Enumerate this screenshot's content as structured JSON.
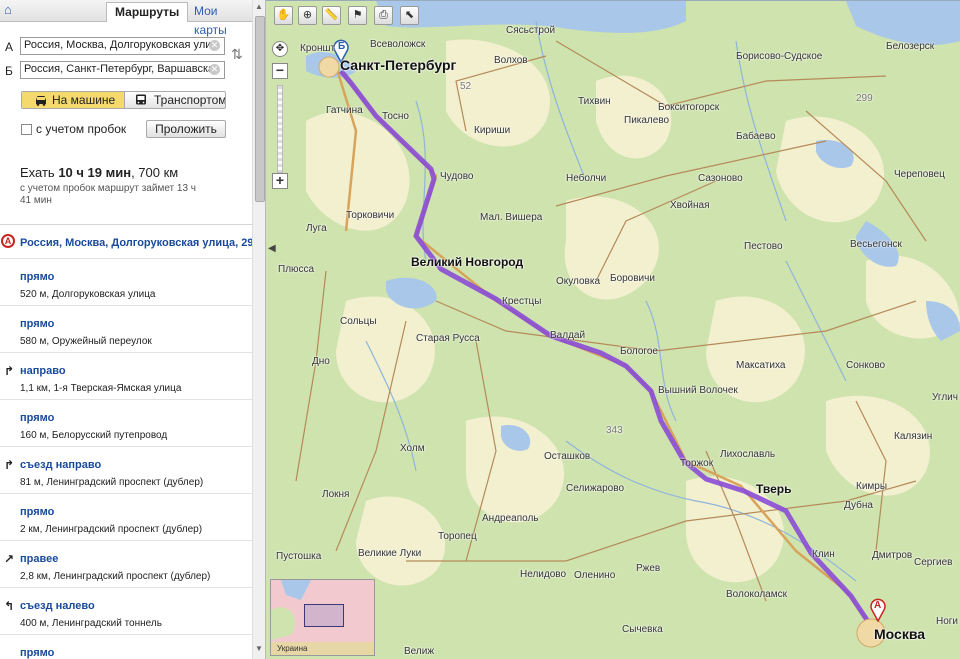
{
  "panel": {
    "tabs": {
      "routes": "Маршруты",
      "my_maps": "Мои карты"
    },
    "point_a_label": "А",
    "point_b_label": "Б",
    "from_value": "Россия, Москва, Долгоруковская ули",
    "to_value": "Россия, Санкт-Петербург, Варшавска",
    "mode_car": "На машине",
    "mode_transit": "Транспортом",
    "traffic_label": "с учетом пробок",
    "build_button": "Проложить",
    "summary_prefix": "Ехать ",
    "summary_time": "10 ч 19 мин",
    "summary_distance": ", 700 км",
    "summary_note": "с учетом пробок маршрут займет 13 ч 41 мин",
    "start_marker": "А",
    "start_address": "Россия, Москва, Долгоруковская улица, 29",
    "steps": [
      {
        "title": "прямо",
        "detail": "520 м, Долгоруковская улица",
        "turn": ""
      },
      {
        "title": "прямо",
        "detail": "580 м, Оружейный переулок",
        "turn": ""
      },
      {
        "title": "направо",
        "detail": "1,1 км, 1-я Тверская-Ямская улица",
        "turn": "↱"
      },
      {
        "title": "прямо",
        "detail": "160 м, Белорусский путепровод",
        "turn": ""
      },
      {
        "title": "съезд направо",
        "detail": "81 м, Ленинградский проспект (дублер)",
        "turn": "↱"
      },
      {
        "title": "прямо",
        "detail": "2 км, Ленинградский проспект (дублер)",
        "turn": ""
      },
      {
        "title": "правее",
        "detail": "2,8 км, Ленинградский проспект (дублер)",
        "turn": "↗"
      },
      {
        "title": "съезд налево",
        "detail": "400 м, Ленинградский тоннель",
        "turn": "↰"
      },
      {
        "title": "прямо",
        "detail": "",
        "turn": ""
      }
    ]
  },
  "map": {
    "marker_a": "А",
    "marker_b": "Б",
    "minimap_label": "Украина",
    "route_color": "#8a4bd6",
    "cities": {
      "spb": "Санкт-Петербург",
      "moscow": "Москва",
      "novgorod": "Великий Новгород",
      "tver": "Тверь",
      "kronsht": "Кроншт",
      "vsevolozhsk": "Всеволожск",
      "syasstroy": "Сясьстрой",
      "volkhov": "Волхов",
      "gatchina": "Гатчина",
      "tosno": "Тосно",
      "kirishi": "Кириши",
      "tikhvin": "Тихвин",
      "pikalevo": "Пикалево",
      "boksitogorsk": "Бокситогорск",
      "babaevo": "Бабаево",
      "borisovo": "Борисово-Судское",
      "belozersk": "Белозерск",
      "cherepovets": "Череповец",
      "chudovo": "Чудово",
      "nebolchi": "Неболчи",
      "sazonovo": "Сазоново",
      "khvoynaya": "Хвойная",
      "luga": "Луга",
      "torkovichi": "Торковичи",
      "mvishera": "Мал. Вишера",
      "pestovo": "Пестово",
      "vesyegonsk": "Весьегонск",
      "plyussa": "Плюсса",
      "okulovka": "Окуловка",
      "borovichi": "Боровичи",
      "soltsy": "Сольцы",
      "kresttsy": "Крестцы",
      "valday": "Валдай",
      "staraya_russa": "Старая Русса",
      "bologoe": "Бологое",
      "maksatikha": "Максатиха",
      "sonkovo": "Сонково",
      "dno": "Дно",
      "vvolochek": "Вышний Волочек",
      "uglich": "Углич",
      "likhoslavl": "Лихославль",
      "kalyazin": "Калязин",
      "kholm": "Холм",
      "ostashkov": "Осташков",
      "torzhok": "Торжок",
      "kimry": "Кимры",
      "selizharovo": "Селижарово",
      "dubna": "Дубна",
      "lokhnya": "Локня",
      "andreapol": "Андреаполь",
      "klin": "Клин",
      "toropets": "Торопец",
      "dmitrov": "Дмитров",
      "sergiev": "Сергиев",
      "pustoshka": "Пустошка",
      "vluki": "Великие Луки",
      "nelidovo": "Нелидово",
      "olenino": "Оленино",
      "rzhev": "Ржев",
      "volokolamsk": "Волоколамск",
      "sychevka": "Сычевка",
      "velizh": "Велиж",
      "noginsk": "Ноги"
    },
    "numbers": {
      "n52": "52",
      "n299": "299",
      "n343": "343"
    },
    "tools": [
      "hand-tool",
      "zoom-tool",
      "ruler-tool",
      "route-tool",
      "print-tool",
      "select-tool"
    ]
  }
}
